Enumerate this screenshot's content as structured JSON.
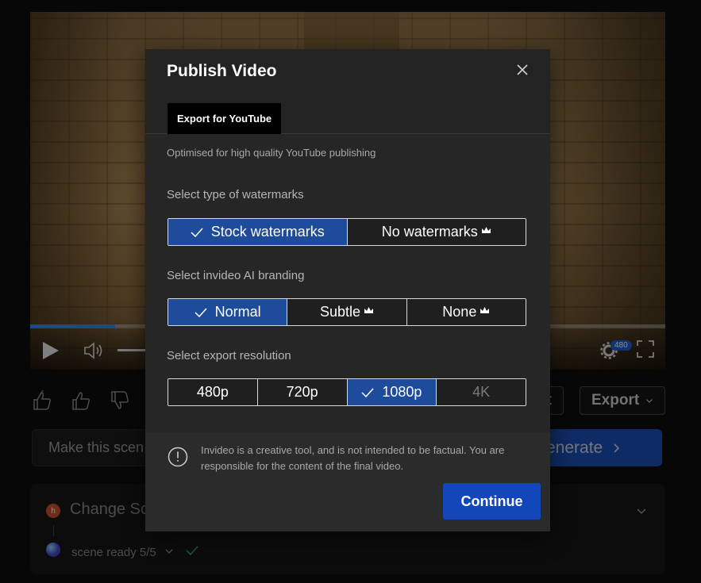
{
  "video": {
    "resolution_badge": "480",
    "progress": 0.134
  },
  "below_video": {
    "export_label": "Export",
    "edit_partial": "t",
    "scene_input_placeholder": "Make this scen",
    "regenerate_label": "enerate"
  },
  "change_card": {
    "avatar_letter": "h",
    "title": "Change Sc",
    "status": "scene ready 5/5"
  },
  "modal": {
    "title": "Publish Video",
    "tab_label": "Export for YouTube",
    "subtitle": "Optimised for high quality YouTube publishing",
    "watermarks": {
      "label": "Select type of watermarks",
      "options": [
        {
          "label": "Stock watermarks",
          "selected": true,
          "premium": false
        },
        {
          "label": "No watermarks",
          "selected": false,
          "premium": true
        }
      ]
    },
    "branding": {
      "label": "Select invideo AI branding",
      "options": [
        {
          "label": "Normal",
          "selected": true,
          "premium": false
        },
        {
          "label": "Subtle",
          "selected": false,
          "premium": true
        },
        {
          "label": "None",
          "selected": false,
          "premium": true
        }
      ]
    },
    "resolution": {
      "label": "Select export resolution",
      "options": [
        {
          "label": "480p",
          "selected": false,
          "disabled": false
        },
        {
          "label": "720p",
          "selected": false,
          "disabled": false
        },
        {
          "label": "1080p",
          "selected": true,
          "disabled": false
        },
        {
          "label": "4K",
          "selected": false,
          "disabled": true
        }
      ]
    },
    "disclaimer": "Invideo is a creative tool, and is not intended to be factual. You are responsible for the content of the final video.",
    "continue_label": "Continue"
  },
  "colors": {
    "accent": "#1e4c9a",
    "primary_button": "#1346b8",
    "modal_bg": "#232323"
  }
}
